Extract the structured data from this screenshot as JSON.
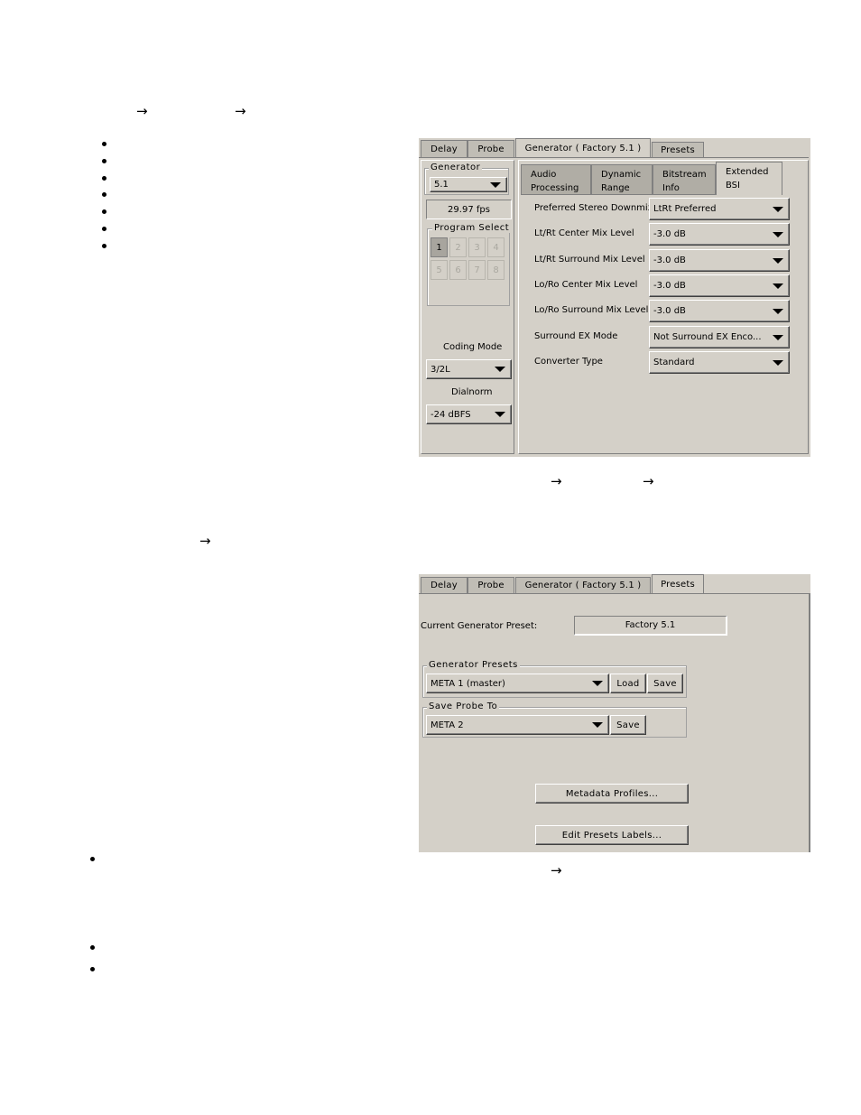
{
  "arrows": [
    "→",
    "→",
    "→",
    "→",
    "→",
    "→"
  ],
  "panel1": {
    "tabs": [
      "Delay",
      "Probe",
      "Generator ( Factory 5.1 )",
      "Presets"
    ],
    "subtabs": [
      {
        "line1": "Audio",
        "line2": "Processing"
      },
      {
        "line1": "Dynamic",
        "line2": "Range"
      },
      {
        "line1": "Bitstream",
        "line2": "Info"
      },
      {
        "line1": "Extended",
        "line2": "BSI"
      }
    ],
    "generator": {
      "title": "Generator",
      "value": "5.1",
      "fps": "29.97 fps",
      "program_select_title": "Program Select",
      "programs": [
        "1",
        "2",
        "3",
        "4",
        "5",
        "6",
        "7",
        "8"
      ],
      "selected_program": "1",
      "coding_mode_label": "Coding Mode",
      "coding_mode_value": "3/2L",
      "dialnorm_label": "Dialnorm",
      "dialnorm_value": "-24 dBFS"
    },
    "rows": [
      {
        "label": "Preferred Stereo Downmix",
        "value": "LtRt Preferred"
      },
      {
        "label": "Lt/Rt Center Mix Level",
        "value": "-3.0 dB"
      },
      {
        "label": "Lt/Rt Surround Mix Level",
        "value": "-3.0 dB"
      },
      {
        "label": "Lo/Ro Center Mix Level",
        "value": "-3.0 dB"
      },
      {
        "label": "Lo/Ro Surround Mix Level",
        "value": "-3.0 dB"
      },
      {
        "label": "Surround EX Mode",
        "value": "Not Surround EX Enco..."
      },
      {
        "label": "Converter Type",
        "value": "Standard"
      }
    ]
  },
  "panel2": {
    "tabs": [
      "Delay",
      "Probe",
      "Generator ( Factory 5.1 )",
      "Presets"
    ],
    "current_preset_label": "Current Generator Preset:",
    "current_preset_value": "Factory 5.1",
    "generator_presets": {
      "title": "Generator Presets",
      "value": "META 1 (master)",
      "load": "Load",
      "save": "Save"
    },
    "save_probe": {
      "title": "Save Probe To",
      "value": "META 2",
      "save": "Save"
    },
    "metadata_profiles": "Metadata Profiles...",
    "edit_presets_labels": "Edit Presets Labels..."
  }
}
